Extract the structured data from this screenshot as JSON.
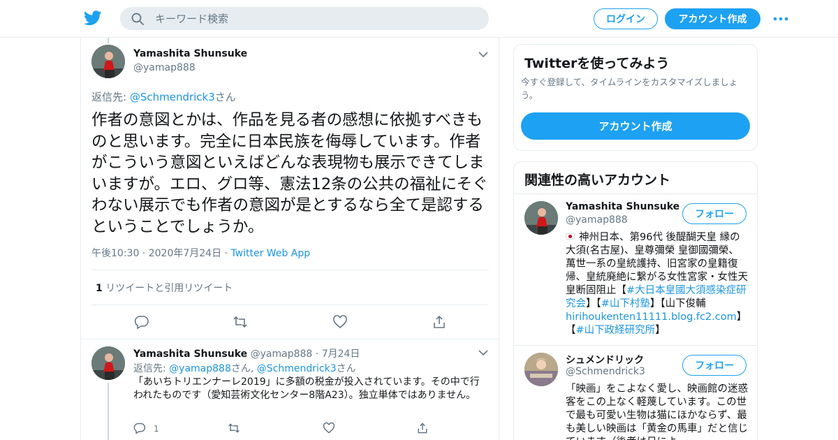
{
  "header": {
    "search_placeholder": "キーワード検索",
    "login_label": "ログイン",
    "signup_label": "アカウント作成"
  },
  "focus_tweet": {
    "author_name": "Yamashita Shunsuke",
    "author_handle": "@yamap888",
    "reply_label": "返信先: ",
    "reply_to": "@Schmendrick3",
    "reply_suffix": "さん",
    "text": "作者の意図とかは、作品を見る者の感想に依拠すべきものと思います。完全に日本民族を侮辱しています。作者がこういう意図といえばどんな表現物も展示できてしまいますが。エロ、グロ等、憲法12条の公共の福祉にそぐわない展示でも作者の意図が是とするなら全て是認するということでしょうか。",
    "time": "午後10:30",
    "date": "2020年7月24日",
    "source": "Twitter Web App",
    "retweet_count": "1",
    "retweet_label": "リツイートと引用リツイート"
  },
  "reply_tweet": {
    "author_name": "Yamashita Shunsuke",
    "author_handle": "@yamap888",
    "date": "7月24日",
    "reply_label": "返信先: ",
    "reply_to_1": "@yamap888",
    "reply_mid": "さん, ",
    "reply_to_2": "@Schmendrick3",
    "reply_suffix": "さん",
    "text": "「あいちトリエンナーレ2019」に多額の税金が投入されています。その中で行われたものです（愛知芸術文化センター8階A23）。独立単体ではありません。",
    "reply_count": "1"
  },
  "signup_card": {
    "title": "Twitterを使ってみよう",
    "subtitle": "今すぐ登録して、タイムラインをカスタマイズしましょう。",
    "button": "アカウント作成"
  },
  "related": {
    "title": "関連性の高いアカウント",
    "follow_label": "フォロー",
    "accounts": [
      {
        "name": "Yamashita Shunsuke",
        "handle": "@yamap888",
        "bio_1": "神州日本、第96代 後醍醐天皇 縁の大須(名古屋)、皇尊彌榮 皇御國彌榮、萬世一系の皇統護持、旧宮家の皇籍復帰、皇統廃絶に繋がる女性宮家・女性天皇断固阻止【",
        "bio_tag_1": "#大日本皇國大須感染症研究会",
        "bio_2": "】【",
        "bio_tag_2": "#山下村塾",
        "bio_3": "】【山下俊輔",
        "bio_link": "hirihoukenten11111.blog.fc2.com",
        "bio_4": "】【",
        "bio_tag_3": "#山下政経研究所",
        "bio_5": "】"
      },
      {
        "name": "シュメンドリック",
        "handle": "@Schmendrick3",
        "bio": "「映画」をこよなく愛し、映画館の迷惑客をこの上なく軽蔑しています。この世で最も可愛い生物は猫にほかならず、最も美しい映画は「黄金の馬車」だと信じています（後者は日によ"
      }
    ]
  }
}
